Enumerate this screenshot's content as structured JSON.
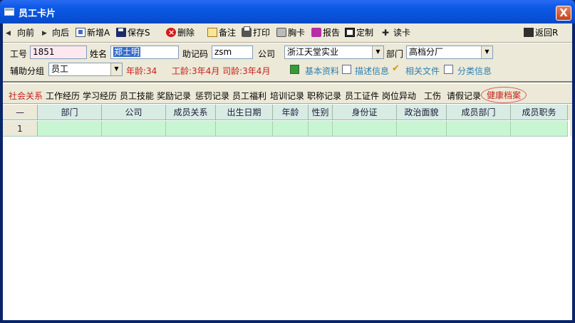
{
  "window": {
    "title": "员工卡片",
    "close_glyph": "X"
  },
  "toolbar": {
    "back": "向前",
    "forward": "向后",
    "new": "新增A",
    "save": "保存S",
    "delete": "删除",
    "note": "备注",
    "print": "打印",
    "badge": "胸卡",
    "report": "报告",
    "custom": "定制",
    "read_card": "读卡",
    "return": "返回R"
  },
  "form": {
    "emp_no_label": "工号",
    "emp_no_value": "1851",
    "name_label": "姓名",
    "name_value": "郑士明",
    "mnemonic_label": "助记码",
    "mnemonic_value": "zsm",
    "company_label": "公司",
    "company_value": "浙江天堂实业",
    "dept_label": "部门",
    "dept_value": "高档分厂",
    "group_label": "辅助分组",
    "group_value": "员工",
    "age_text": "年龄:34",
    "seniority_text": "工龄:3年4月  司龄:3年4月",
    "links": {
      "basic": "基本资料",
      "describe": "描述信息",
      "files": "相关文件",
      "category": "分类信息"
    }
  },
  "tabs": [
    "社会关系",
    "工作经历",
    "学习经历",
    "员工技能",
    "奖励记录",
    "惩罚记录",
    "员工福利",
    "培训记录",
    "职称记录",
    "员工证件",
    "岗位异动",
    "工伤",
    "请假记录",
    "健康档案"
  ],
  "grid": {
    "corner": "—",
    "columns": [
      "部门",
      "公司",
      "成员关系",
      "出生日期",
      "年龄",
      "性别",
      "身份证",
      "政治面貌",
      "成员部门",
      "成员职务"
    ],
    "row_numbers": [
      "1"
    ]
  },
  "colors": {
    "title_bar": "#0d5ae8",
    "grid_header": "#d8ece4",
    "grid_row": "#c8f5d2",
    "accent_red": "#c8211b",
    "link_blue": "#2f7fb0"
  }
}
